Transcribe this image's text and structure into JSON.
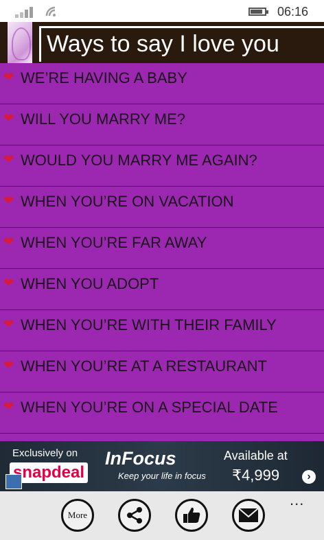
{
  "status_bar": {
    "time": "06:16"
  },
  "header": {
    "title": "Ways to say I love you"
  },
  "list": {
    "items": [
      "WE’RE HAVING A BABY",
      "WILL YOU MARRY ME?",
      "WOULD YOU MARRY ME AGAIN?",
      "WHEN YOU’RE ON VACATION",
      "WHEN YOU’RE FAR AWAY",
      "WHEN YOU ADOPT",
      "WHEN YOU’RE WITH THEIR FAMILY",
      "WHEN YOU’RE AT A RESTAURANT",
      "WHEN YOU’RE ON A SPECIAL DATE"
    ]
  },
  "ad": {
    "exclusive_label": "Exclusively on",
    "store_name": "snapdeal",
    "brand": "InFocus",
    "tagline": "Keep your life in focus",
    "available_label": "Available at",
    "price": "₹4,999"
  },
  "app_bar": {
    "more_label": "More",
    "ellipsis": "..."
  },
  "colors": {
    "list_background": "#9c27b0",
    "header_background": "#2a1a0e",
    "heart": "#d81b3b"
  }
}
